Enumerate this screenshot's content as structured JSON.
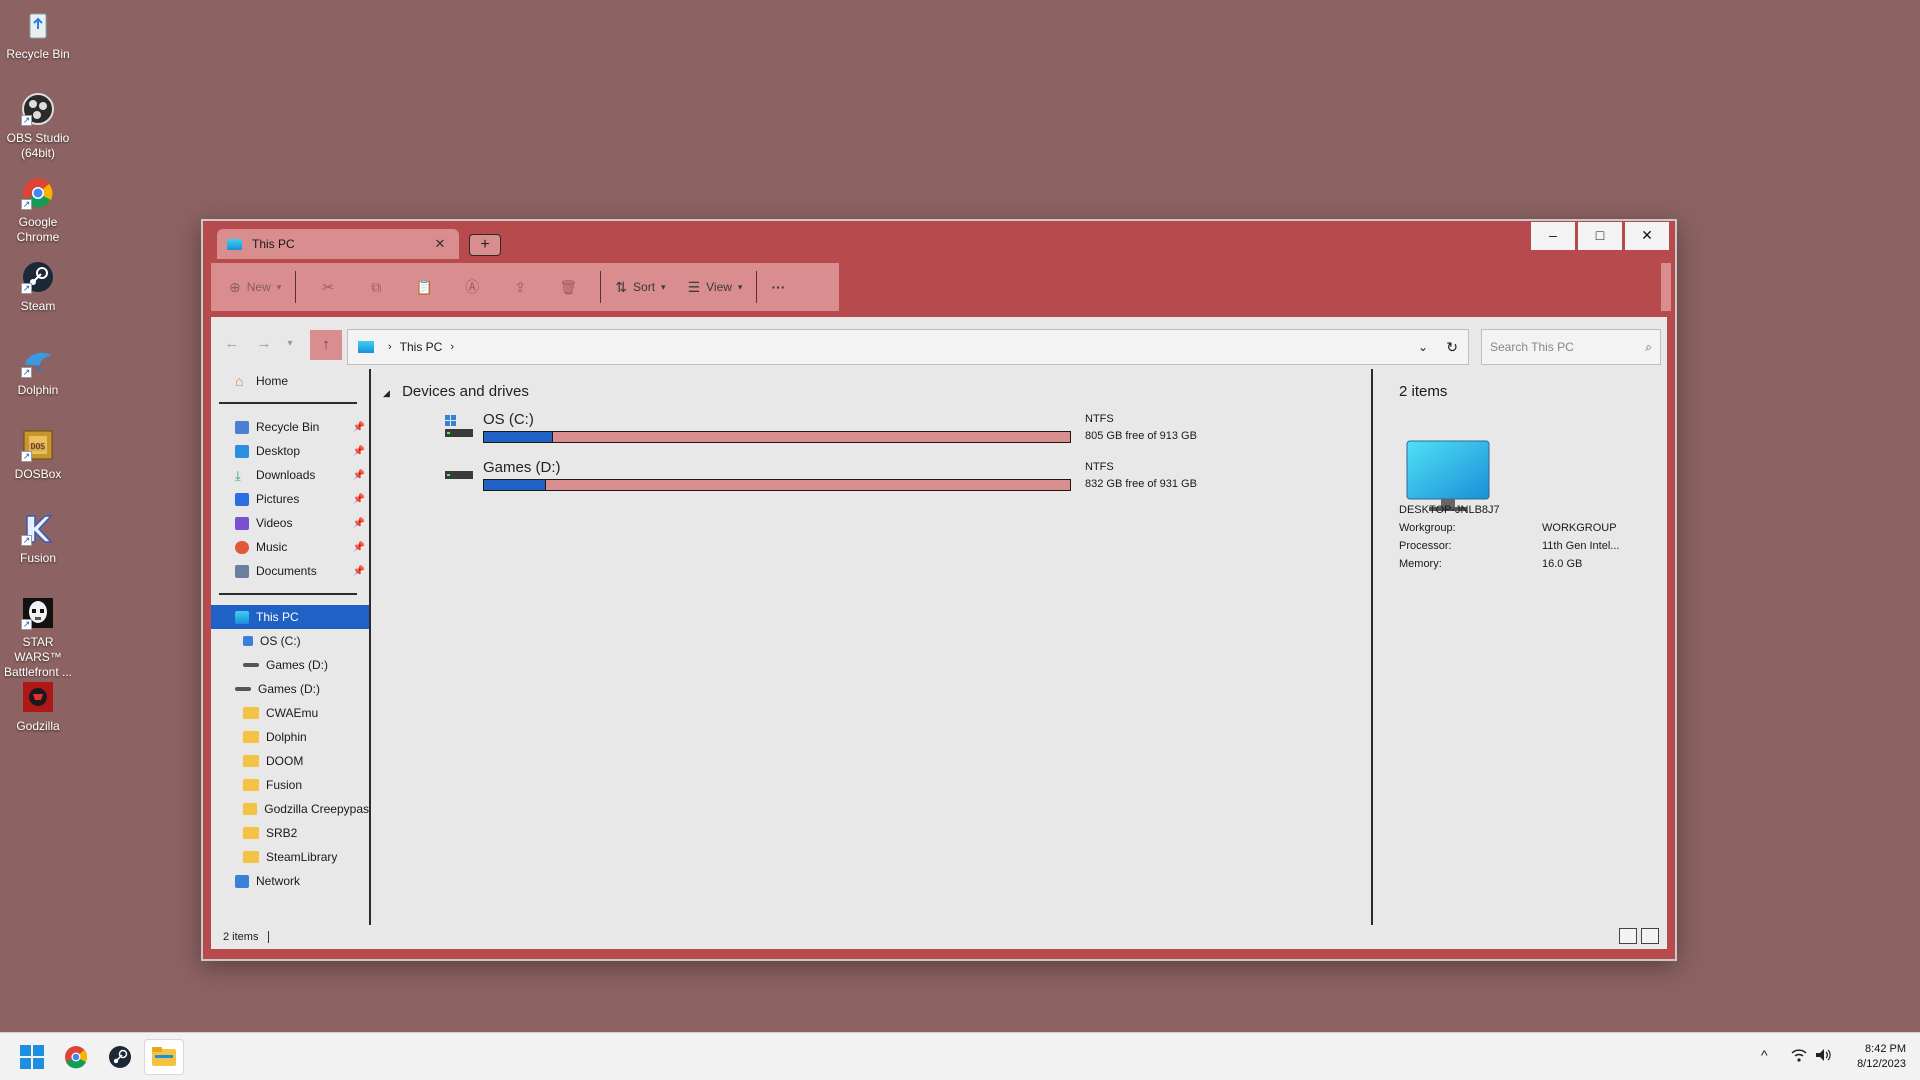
{
  "desktop": {
    "icons": [
      {
        "label": "Recycle Bin"
      },
      {
        "label": "OBS Studio (64bit)"
      },
      {
        "label": "Google Chrome"
      },
      {
        "label": "Steam"
      },
      {
        "label": "Dolphin"
      },
      {
        "label": "DOSBox"
      },
      {
        "label": "Fusion"
      },
      {
        "label": "STAR WARS™ Battlefront ..."
      },
      {
        "label": "Godzilla"
      }
    ]
  },
  "window": {
    "tab_label": "This PC",
    "new_tab_symbol": "+",
    "controls": {
      "minimize": "–",
      "maximize": "□",
      "close": "✕"
    },
    "toolbar": {
      "new_label": "New",
      "sort_label": "Sort",
      "view_label": "View",
      "more_label": "···"
    },
    "address": {
      "crumb": "This PC"
    },
    "search": {
      "placeholder": "Search This PC"
    },
    "nav": {
      "home": "Home",
      "quick_access": [
        {
          "label": "Recycle Bin",
          "color": "#4a7fd4"
        },
        {
          "label": "Desktop",
          "color": "#2a8fe0"
        },
        {
          "label": "Downloads",
          "color": "#2aa36b"
        },
        {
          "label": "Pictures",
          "color": "#2a6fe0"
        },
        {
          "label": "Videos",
          "color": "#7a4fd0"
        },
        {
          "label": "Music",
          "color": "#e05a3a"
        },
        {
          "label": "Documents",
          "color": "#6a7fa0"
        }
      ],
      "this_pc": "This PC",
      "this_pc_children": [
        "OS (C:)",
        "Games (D:)"
      ],
      "games_drive": "Games (D:)",
      "games_folders": [
        "CWAEmu",
        "Dolphin",
        "DOOM",
        "Fusion",
        "Godzilla Creepypas",
        "SRB2",
        "SteamLibrary"
      ],
      "network": "Network"
    },
    "main": {
      "group_title": "Devices and drives",
      "drives": [
        {
          "name": "OS (C:)",
          "fs": "NTFS",
          "free_text": "805 GB free of 913 GB",
          "used_fraction": 0.118
        },
        {
          "name": "Games (D:)",
          "fs": "NTFS",
          "free_text": "832 GB free of 931 GB",
          "used_fraction": 0.106
        }
      ]
    },
    "details": {
      "count": "2 items",
      "computer_name": "DESKTOP-JNLB8J7",
      "rows": [
        {
          "key": "Workgroup:",
          "value": "WORKGROUP"
        },
        {
          "key": "Processor:",
          "value": "11th Gen Intel..."
        },
        {
          "key": "Memory:",
          "value": "16.0 GB"
        }
      ]
    },
    "status": {
      "count": "2 items"
    }
  },
  "taskbar": {
    "clock_time": "8:42 PM",
    "clock_date": "8/12/2023",
    "tray_chevron": "^"
  },
  "colors": {
    "desktop": "#8c6262",
    "window_frame": "#b64a4c",
    "accent_light": "#d98d8f",
    "selection": "#1f61c4"
  }
}
